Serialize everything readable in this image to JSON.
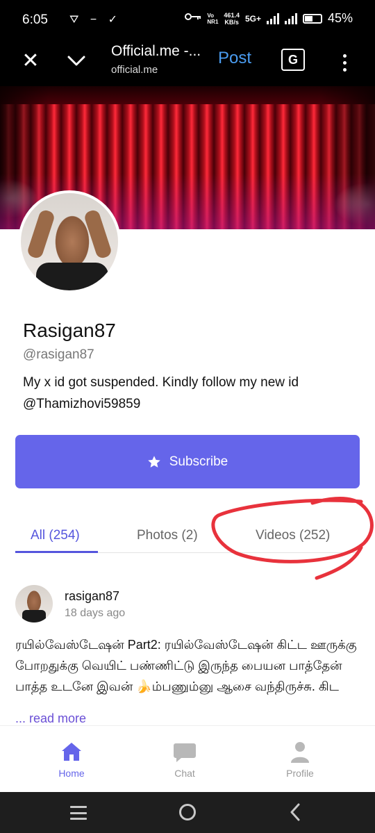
{
  "status_bar": {
    "time": "6:05",
    "left_icons": "⛛ − ✓",
    "volte": "Vo\nNR1",
    "net_speed": "461.4\nKB/s",
    "network": "5G+",
    "battery": "45%"
  },
  "browser": {
    "title": "Official.me -...",
    "url": "official.me",
    "post_label": "Post",
    "translate_label": "G"
  },
  "profile": {
    "display_name": "Rasigan87",
    "handle": "@rasigan87",
    "bio": "My x id got suspended. Kindly follow my new id @Thamizhovi59859",
    "subscribe_label": "Subscribe"
  },
  "tabs": [
    {
      "label": "All (254)"
    },
    {
      "label": "Photos (2)"
    },
    {
      "label": "Videos (252)"
    }
  ],
  "post": {
    "username": "rasigan87",
    "time": "18 days ago",
    "text": "ரயில்வேஸ்டேஷன் Part2: ரயில்வேஸ்டேஷன் கிட்ட ஊருக்கு போறதுக்கு வெயிட் பண்ணிட்டு இருந்த பையன பாத்தேன் பாத்த உடனே இவன் 🍌ம்பணும்னு ஆசை வந்திருச்சு. கிட",
    "read_more": "... read more"
  },
  "bottom_nav": {
    "home": "Home",
    "chat": "Chat",
    "profile": "Profile"
  },
  "colors": {
    "accent": "#6565ea",
    "annotation": "#e8323c",
    "link": "#4a9cf0"
  }
}
